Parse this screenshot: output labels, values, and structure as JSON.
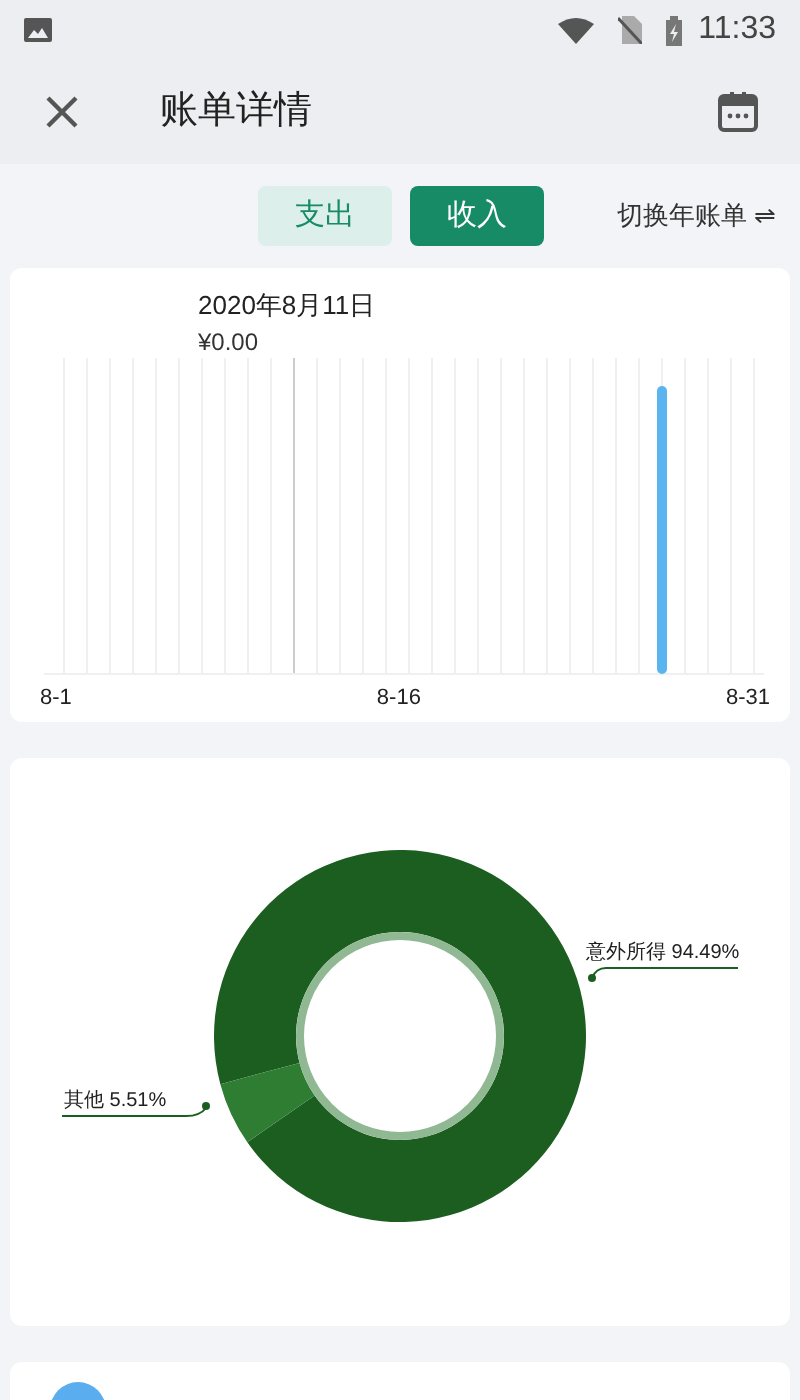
{
  "status_bar": {
    "time": "11:33"
  },
  "header": {
    "title": "账单详情"
  },
  "toggle": [
    {
      "label": "支出",
      "selected": false
    },
    {
      "label": "收入",
      "selected": true
    }
  ],
  "switch_link": {
    "label": "切换年账单",
    "icon": "⇌"
  },
  "daily_card": {
    "date": "2020年8月11日",
    "amount": "¥0.00",
    "x_labels": [
      "8-1",
      "8-16",
      "8-31"
    ]
  },
  "category_card": {
    "chart_data": {
      "type": "donut",
      "categories": [
        "意外所得",
        "其他"
      ],
      "values": [
        94.49,
        5.51
      ],
      "data_labels": true,
      "value_labels": [
        "94.49%",
        "5.51%"
      ]
    }
  }
}
